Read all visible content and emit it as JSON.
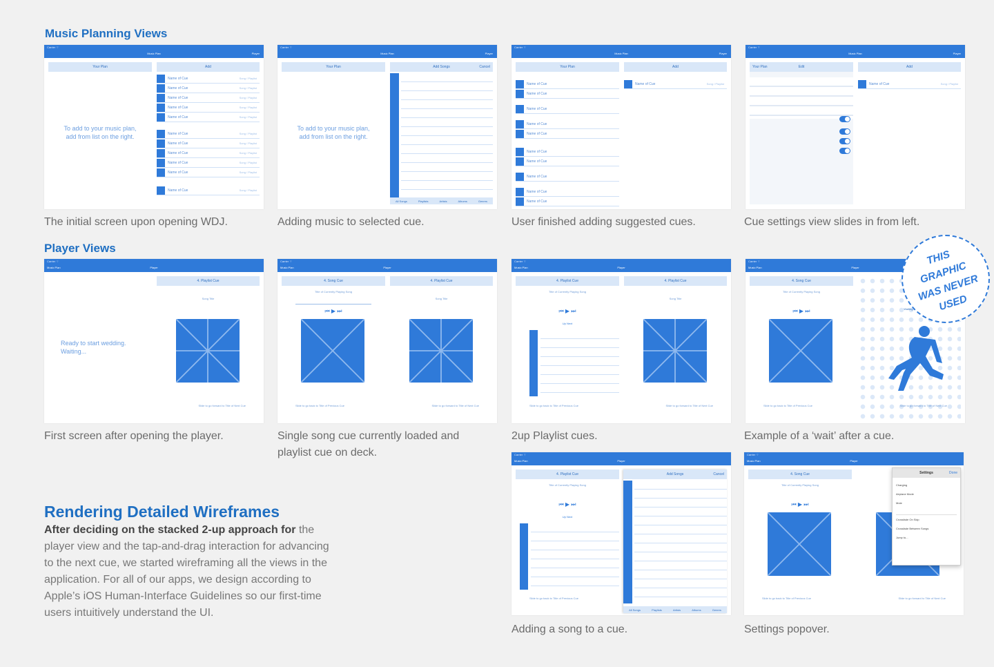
{
  "sections": {
    "planning_title": "Music Planning Views",
    "player_title": "Player Views"
  },
  "captions": {
    "c1": "The initial screen upon opening WDJ.",
    "c2": "Adding music to selected cue.",
    "c3": "User finished adding suggested cues.",
    "c4": "Cue settings view slides in from left.",
    "c5": "First screen after opening the player.",
    "c6": "Single song cue currently loaded and playlist cue on deck.",
    "c7": "2up Playlist cues.",
    "c8": "Example of a ‘wait’ after a cue.",
    "c9": "Adding a song to a cue.",
    "c10": "Settings popover."
  },
  "body": {
    "title": "Rendering Detailed Wireframes",
    "lead": "After deciding on the stacked 2-up approach for",
    "rest": "the player view and the tap-and-drag interaction for advancing to the next cue, we started wireframing all the views in the application. For all of our apps, we design according to Apple’s iOS Human-Interface Guidelines so our first-time users intuitively understand the UI."
  },
  "stamp": {
    "line1": "THIS",
    "line2": "GRAPHIC",
    "line3": "WAS NEVER",
    "line4": "USED"
  },
  "wire": {
    "status": "Carrier ⌔",
    "title_plan": "Music Plan",
    "right_player": "Player",
    "left_musicplan": "Music Plan",
    "your_plan": "Your Plan",
    "add": "Add",
    "add_songs": "Add Songs",
    "cancel": "Cancel",
    "edit": "Edit",
    "hint": "To add to your music plan, add from list on the right.",
    "cue_row": "Name of Cue",
    "cue_meta": "Song / Playlist",
    "song_row": "Song Title",
    "playlist_cue": "4. Playlist Cue",
    "song_cue": "4. Song Cue",
    "song_title": "Song Title",
    "now_playing": "Title of Currently Playing Song",
    "ready": "Ready to start wedding. Waiting...",
    "up_next": "Up Next",
    "slide_prev": "Slide to go back to Title of Previous Cue",
    "slide_next": "Slide to go forward to Title of Next Cue",
    "waiting": "Waiting...",
    "settings": "Settings",
    "done": "Done",
    "tabs": [
      "All Songs",
      "Playlists",
      "Artists",
      "Albums",
      "Genres"
    ],
    "settings_rows": [
      "Charging",
      "Airplane Mode",
      "Mute",
      "Crossfade On Skip",
      "Crossfade Between Songs",
      "Jump to..."
    ]
  }
}
